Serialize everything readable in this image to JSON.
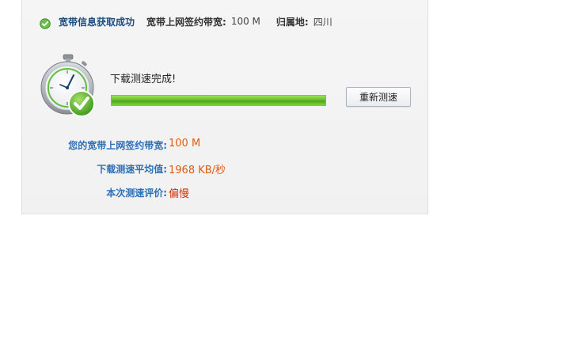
{
  "info_line": {
    "status": "宽带信息获取成功",
    "bandwidth_key": "宽带上网签约带宽:",
    "bandwidth_value": "100 M",
    "location_key": "归属地:",
    "location_value": "四川"
  },
  "test": {
    "status_text": "下载测速完成!",
    "progress": 1.0,
    "retest_label": "重新测速"
  },
  "results": {
    "contract_label": "您的宽带上网签约带宽:",
    "contract_value": "100 M",
    "avg_label": "下载测速平均值:",
    "avg_value": "1968 KB/秒",
    "rating_label": "本次测速评价:",
    "rating_value": "偏慢"
  },
  "colors": {
    "link_blue": "#2c6fb6",
    "value_orange": "#e05a12",
    "progress_green": "#62c02a"
  },
  "icons": {
    "status": "check-circle-icon",
    "timer": "stopwatch-icon"
  }
}
